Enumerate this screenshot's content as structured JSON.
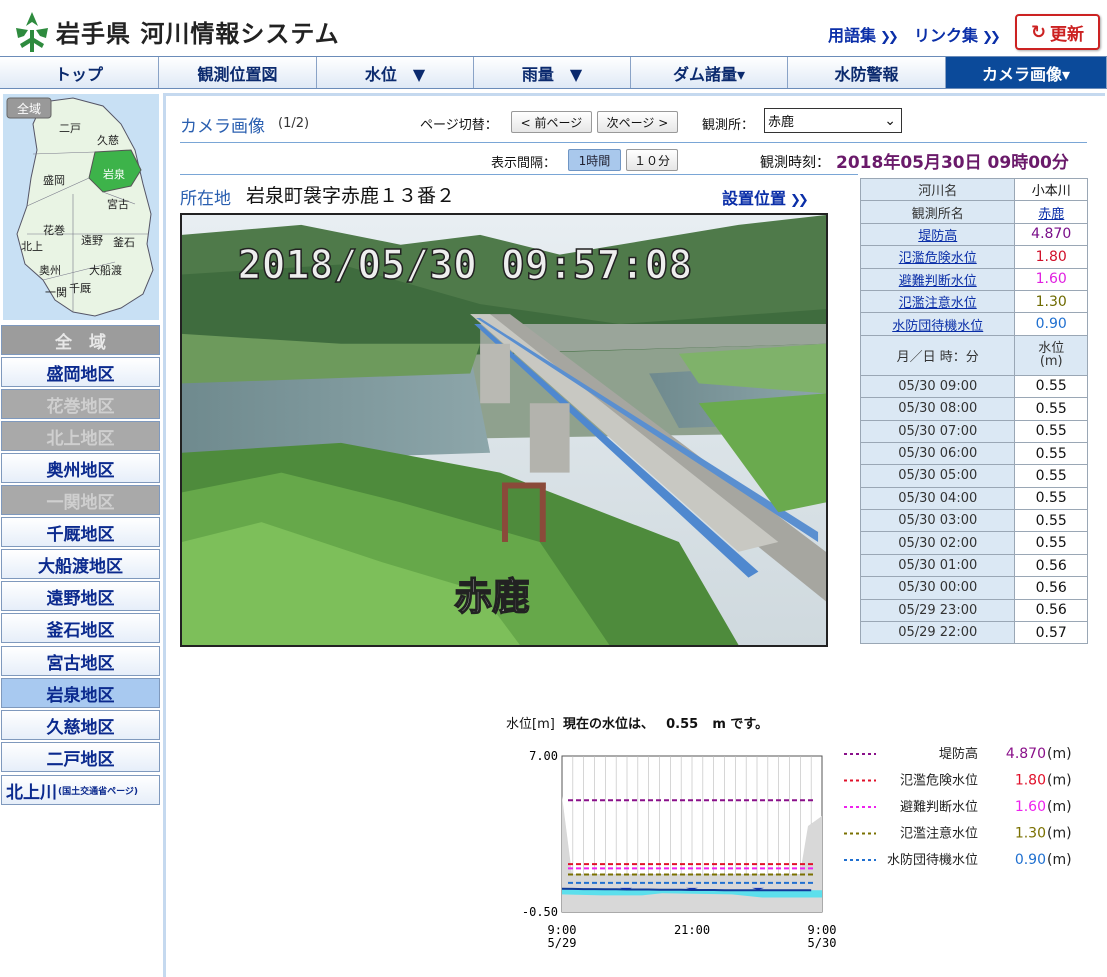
{
  "header": {
    "site_title": "岩手県 河川情報システム",
    "glossary_link": "用語集",
    "links_link": "リンク集",
    "refresh_label": "更新"
  },
  "nav": {
    "items": [
      {
        "label": "トップ"
      },
      {
        "label": "観測位置図"
      },
      {
        "label": "水位　▼"
      },
      {
        "label": "雨量　▼"
      },
      {
        "label": "ダム諸量▾"
      },
      {
        "label": "水防警報"
      },
      {
        "label": "カメラ画像▾"
      }
    ]
  },
  "sidebar": {
    "map": {
      "all_area_tag": "全域",
      "places": [
        "二戸",
        "久慈",
        "盛岡",
        "岩泉",
        "宮古",
        "花巻",
        "遠野",
        "釜石",
        "北上",
        "奥州",
        "大船渡",
        "一関",
        "千厩"
      ]
    },
    "areas": [
      {
        "label": "全　域",
        "state": "head"
      },
      {
        "label": "盛岡地区",
        "state": "on"
      },
      {
        "label": "花巻地区",
        "state": "disabled"
      },
      {
        "label": "北上地区",
        "state": "disabled"
      },
      {
        "label": "奥州地区",
        "state": "on"
      },
      {
        "label": "一関地区",
        "state": "disabled"
      },
      {
        "label": "千厩地区",
        "state": "on"
      },
      {
        "label": "大船渡地区",
        "state": "on"
      },
      {
        "label": "遠野地区",
        "state": "on"
      },
      {
        "label": "釜石地区",
        "state": "on"
      },
      {
        "label": "宮古地区",
        "state": "on"
      },
      {
        "label": "岩泉地区",
        "state": "selected"
      },
      {
        "label": "久慈地区",
        "state": "on"
      },
      {
        "label": "二戸地区",
        "state": "on"
      }
    ],
    "kitakami": {
      "label": "北上川",
      "sub": "(国土交通省ページ)"
    }
  },
  "camera_panel": {
    "title": "カメラ画像",
    "page": "(1/2)",
    "pager_label": "ページ切替：",
    "prev": "< 前ページ",
    "next": "次ページ >",
    "station_label": "観測所：",
    "station_value": "赤鹿",
    "interval_label": "表示間隔：",
    "interval_1h": "1時間",
    "interval_10m": "１０分",
    "obs_time_label": "観測時刻：",
    "obs_time": "2018年05月30日 09時00分",
    "location_label": "所在地",
    "location_value": "岩泉町袰字赤鹿１３番２",
    "position_link": "設置位置",
    "image": {
      "timestamp": "2018/05/30 09:57:08",
      "name": "赤鹿"
    }
  },
  "info_table": {
    "river_label": "河川名",
    "river": "小本川",
    "station_name_label": "観測所名",
    "station_name": "赤鹿",
    "levels": [
      {
        "label": "堤防高",
        "value": "4.870",
        "color": "#7a0f8a"
      },
      {
        "label": "氾濫危険水位",
        "value": "1.80",
        "color": "#d0102a"
      },
      {
        "label": "避難判断水位",
        "value": "1.60",
        "color": "#e020e0"
      },
      {
        "label": "氾濫注意水位",
        "value": "1.30",
        "color": "#6e6a00"
      },
      {
        "label": "水防団待機水位",
        "value": "0.90",
        "color": "#2070d0"
      }
    ],
    "col_time": "月／日 時：分",
    "col_level": "水位\n(m)",
    "rows": [
      {
        "time": "05/30 09:00",
        "level": "0.55"
      },
      {
        "time": "05/30 08:00",
        "level": "0.55"
      },
      {
        "time": "05/30 07:00",
        "level": "0.55"
      },
      {
        "time": "05/30 06:00",
        "level": "0.55"
      },
      {
        "time": "05/30 05:00",
        "level": "0.55"
      },
      {
        "time": "05/30 04:00",
        "level": "0.55"
      },
      {
        "time": "05/30 03:00",
        "level": "0.55"
      },
      {
        "time": "05/30 02:00",
        "level": "0.55"
      },
      {
        "time": "05/30 01:00",
        "level": "0.56"
      },
      {
        "time": "05/30 00:00",
        "level": "0.56"
      },
      {
        "time": "05/29 23:00",
        "level": "0.56"
      },
      {
        "time": "05/29 22:00",
        "level": "0.57"
      }
    ]
  },
  "graph": {
    "caption_prefix": "水位[m]",
    "caption_main": "現在の水位は、",
    "current": "0.55",
    "caption_suffix": "m です。"
  },
  "chart_data": {
    "type": "area",
    "ylabel": "水位[m]",
    "ylim": [
      -0.5,
      7.0
    ],
    "y_ticks": [
      "7.00",
      "-0.50"
    ],
    "x_ticks": [
      {
        "label": "9:00\n5/29"
      },
      {
        "label": "21:00"
      },
      {
        "label": "9:00\n5/30"
      }
    ],
    "thresholds": [
      {
        "name": "堤防高",
        "value": 4.87,
        "display": "4.870",
        "unit": "(m)",
        "color": "#8a108a"
      },
      {
        "name": "氾濫危険水位",
        "value": 1.8,
        "display": "1.80",
        "unit": "(m)",
        "color": "#e0102a"
      },
      {
        "name": "避難判断水位",
        "value": 1.6,
        "display": "1.60",
        "unit": "(m)",
        "color": "#ee22ee"
      },
      {
        "name": "氾濫注意水位",
        "value": 1.3,
        "display": "1.30",
        "unit": "(m)",
        "color": "#7a7000"
      },
      {
        "name": "水防団待機水位",
        "value": 0.9,
        "display": "0.90",
        "unit": "(m)",
        "color": "#2070d0"
      }
    ],
    "series": [
      {
        "values": [
          0.62,
          0.61,
          0.6,
          0.6,
          0.59,
          0.59,
          0.58,
          0.58,
          0.58,
          0.57,
          0.57,
          0.57,
          0.56,
          0.56,
          0.56,
          0.55,
          0.55,
          0.55,
          0.55,
          0.55,
          0.55,
          0.55,
          0.55,
          0.55,
          0.55
        ]
      }
    ]
  }
}
